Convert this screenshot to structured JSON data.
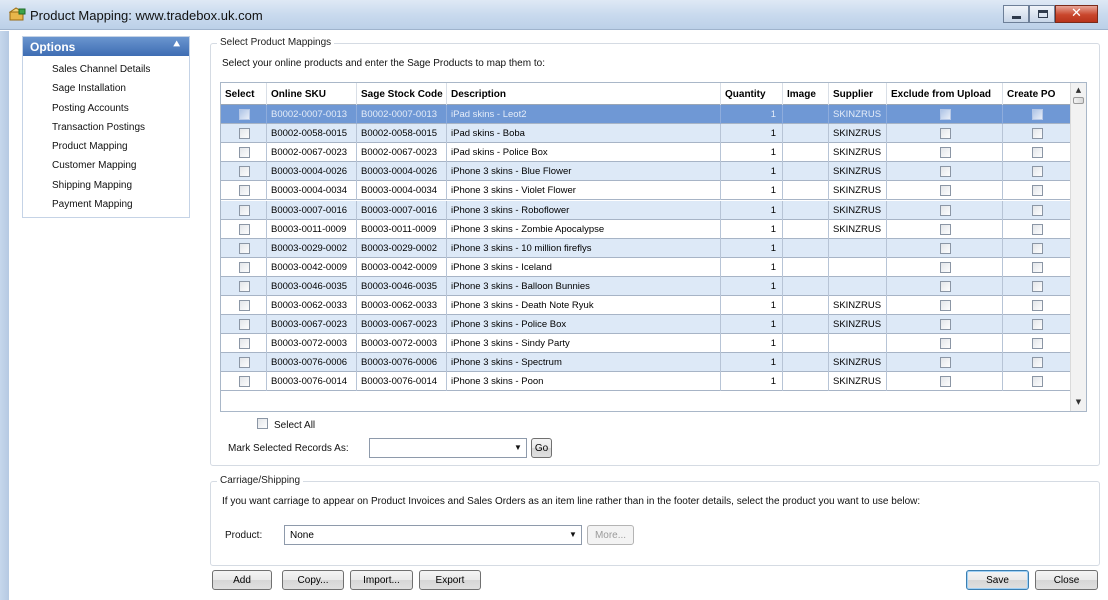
{
  "window": {
    "title": "Product Mapping: www.tradebox.uk.com"
  },
  "options": {
    "header": "Options",
    "items": [
      {
        "label": "Sales Channel Details"
      },
      {
        "label": "Sage Installation"
      },
      {
        "label": "Posting Accounts"
      },
      {
        "label": "Transaction Postings"
      },
      {
        "label": "Product Mapping"
      },
      {
        "label": "Customer Mapping"
      },
      {
        "label": "Shipping Mapping"
      },
      {
        "label": "Payment Mapping"
      }
    ]
  },
  "mappings": {
    "legend": "Select Product Mappings",
    "instruction": "Select your online products and enter the Sage Products to map them to:",
    "columns": [
      "Select",
      "Online SKU",
      "Sage Stock Code",
      "Description",
      "Quantity",
      "Image",
      "Supplier",
      "Exclude from Upload",
      "Create PO"
    ],
    "rows": [
      {
        "sku": "B0002-0007-0013",
        "stock": "B0002-0007-0013",
        "desc": "iPad skins - Leot2",
        "qty": "1",
        "image": "",
        "supplier": "SKINZRUS"
      },
      {
        "sku": "B0002-0058-0015",
        "stock": "B0002-0058-0015",
        "desc": "iPad skins - Boba",
        "qty": "1",
        "image": "",
        "supplier": "SKINZRUS"
      },
      {
        "sku": "B0002-0067-0023",
        "stock": "B0002-0067-0023",
        "desc": "iPad skins - Police Box",
        "qty": "1",
        "image": "",
        "supplier": "SKINZRUS"
      },
      {
        "sku": "B0003-0004-0026",
        "stock": "B0003-0004-0026",
        "desc": "iPhone 3 skins - Blue Flower",
        "qty": "1",
        "image": "",
        "supplier": "SKINZRUS"
      },
      {
        "sku": "B0003-0004-0034",
        "stock": "B0003-0004-0034",
        "desc": "iPhone 3 skins - Violet Flower",
        "qty": "1",
        "image": "",
        "supplier": "SKINZRUS"
      },
      {
        "sku": "B0003-0007-0016",
        "stock": "B0003-0007-0016",
        "desc": "iPhone 3 skins - Roboflower",
        "qty": "1",
        "image": "",
        "supplier": "SKINZRUS"
      },
      {
        "sku": "B0003-0011-0009",
        "stock": "B0003-0011-0009",
        "desc": "iPhone 3 skins - Zombie Apocalypse",
        "qty": "1",
        "image": "",
        "supplier": "SKINZRUS"
      },
      {
        "sku": "B0003-0029-0002",
        "stock": "B0003-0029-0002",
        "desc": "iPhone 3 skins - 10 million fireflys",
        "qty": "1",
        "image": "",
        "supplier": ""
      },
      {
        "sku": "B0003-0042-0009",
        "stock": "B0003-0042-0009",
        "desc": "iPhone 3 skins - Iceland",
        "qty": "1",
        "image": "",
        "supplier": ""
      },
      {
        "sku": "B0003-0046-0035",
        "stock": "B0003-0046-0035",
        "desc": "iPhone 3 skins - Balloon Bunnies",
        "qty": "1",
        "image": "",
        "supplier": ""
      },
      {
        "sku": "B0003-0062-0033",
        "stock": "B0003-0062-0033",
        "desc": "iPhone 3 skins - Death Note Ryuk",
        "qty": "1",
        "image": "",
        "supplier": "SKINZRUS"
      },
      {
        "sku": "B0003-0067-0023",
        "stock": "B0003-0067-0023",
        "desc": "iPhone 3 skins - Police Box",
        "qty": "1",
        "image": "",
        "supplier": "SKINZRUS"
      },
      {
        "sku": "B0003-0072-0003",
        "stock": "B0003-0072-0003",
        "desc": "iPhone 3 skins - Sindy Party",
        "qty": "1",
        "image": "",
        "supplier": ""
      },
      {
        "sku": "B0003-0076-0006",
        "stock": "B0003-0076-0006",
        "desc": "iPhone 3 skins - Spectrum",
        "qty": "1",
        "image": "",
        "supplier": "SKINZRUS"
      },
      {
        "sku": "B0003-0076-0014",
        "stock": "B0003-0076-0014",
        "desc": "iPhone 3 skins - Poon",
        "qty": "1",
        "image": "",
        "supplier": "SKINZRUS"
      }
    ],
    "select_all_label": "Select All",
    "mark_label": "Mark Selected Records As:",
    "mark_value": "",
    "go_label": "Go"
  },
  "carriage": {
    "legend": "Carriage/Shipping",
    "instruction": "If you want carriage to appear on Product Invoices and Sales Orders as an item line rather than in the footer details, select the product you want to use below:",
    "product_label": "Product:",
    "product_value": "None",
    "more_label": "More..."
  },
  "footer": {
    "add_label": "Add",
    "copy_label": "Copy...",
    "import_label": "Import...",
    "export_label": "Export",
    "save_label": "Save",
    "close_label": "Close"
  },
  "colors": {
    "selected_row": "#6f98d5",
    "alt_row": "#dde9f7",
    "options_header": "#4a78bd"
  }
}
